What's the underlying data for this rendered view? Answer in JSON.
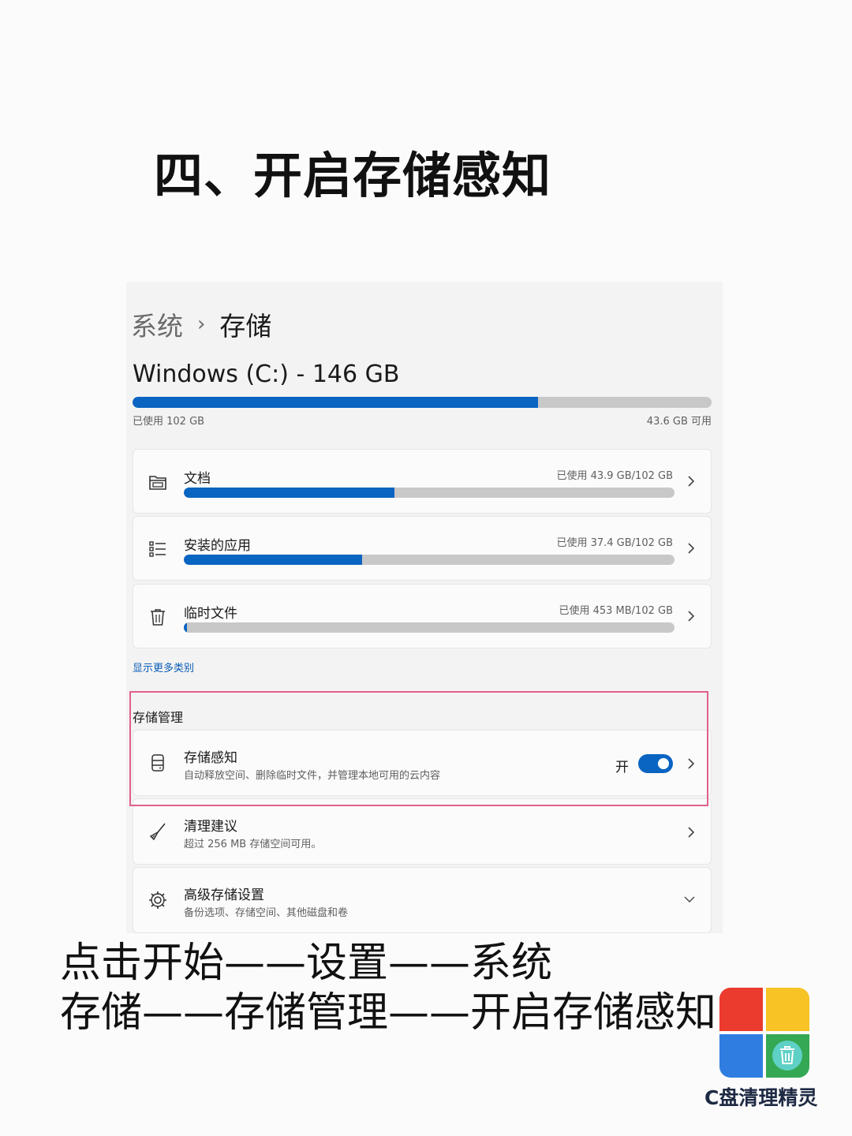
{
  "heading": "四、开启存储感知",
  "breadcrumb": {
    "parent": "系统",
    "separator": "›",
    "current": "存储"
  },
  "drive": {
    "title": "Windows (C:) - 146 GB",
    "used_text": "已使用 102 GB",
    "free_text": "43.6 GB 可用",
    "used_fraction": 0.7
  },
  "categories": [
    {
      "icon": "folder-icon",
      "label": "文档",
      "usage": "已使用 43.9 GB/102 GB",
      "fraction": 0.43
    },
    {
      "icon": "list-icon",
      "label": "安装的应用",
      "usage": "已使用 37.4 GB/102 GB",
      "fraction": 0.363
    },
    {
      "icon": "trash-icon",
      "label": "临时文件",
      "usage": "已使用 453 MB/102 GB",
      "fraction": 0.005
    }
  ],
  "more_link": "显示更多类别",
  "storage_management": {
    "title": "存储管理",
    "storage_sense": {
      "title": "存储感知",
      "subtitle": "自动释放空间、删除临时文件，并管理本地可用的云内容",
      "toggle_label": "开",
      "toggle_on": true
    },
    "cleanup": {
      "title": "清理建议",
      "subtitle": "超过 256 MB 存储空间可用。"
    },
    "advanced": {
      "title": "高级存储设置",
      "subtitle": "备份选项、存储空间、其他磁盘和卷"
    }
  },
  "instructions": {
    "line1": "点击开始——设置——系统",
    "line2": "存储——存储管理——开启存储感知"
  },
  "logo": {
    "text": "C盘清理精灵",
    "colors": {
      "red": "#ea3b2e",
      "yellow": "#f7c325",
      "blue": "#2f7de1",
      "green": "#34a853"
    }
  },
  "accent": "#0a64c2",
  "highlight_color": "#e0608a"
}
